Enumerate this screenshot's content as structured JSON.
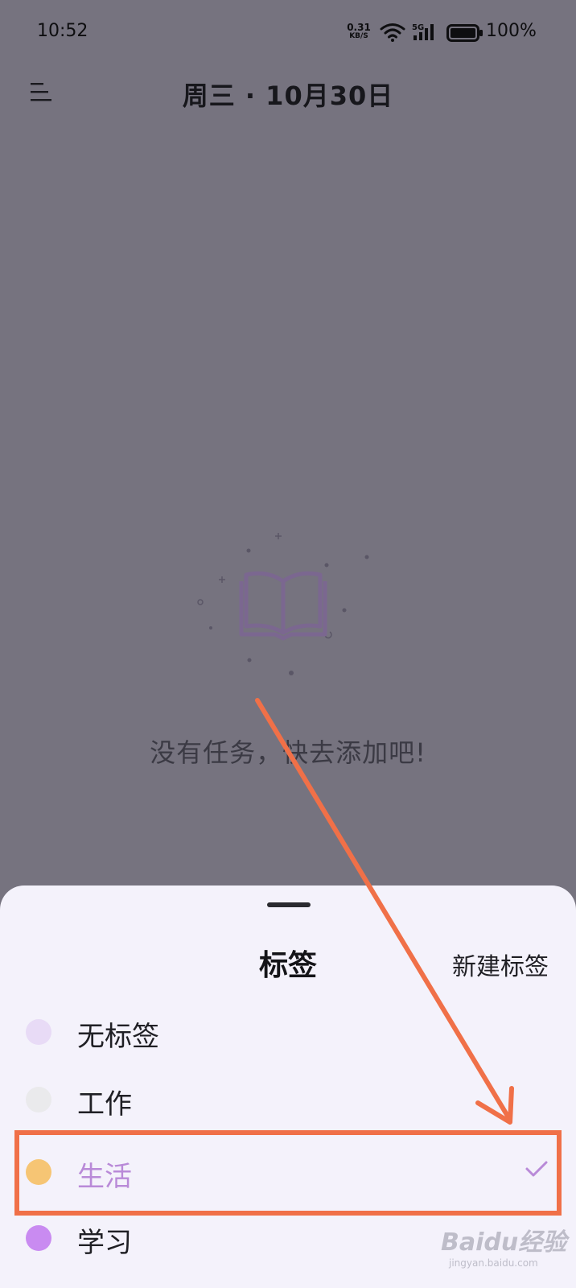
{
  "status_bar": {
    "time": "10:52",
    "net_speed_value": "0.31",
    "net_speed_unit": "KB/S",
    "signal_label": "5G",
    "battery": "100%"
  },
  "header": {
    "menu_icon": "menu-icon",
    "title": "周三 · 10月30日"
  },
  "empty_state": {
    "illustration": "open-book-icon",
    "message": "没有任务，快去添加吧!"
  },
  "sheet": {
    "title": "标签",
    "new_tag_label": "新建标签",
    "tags": [
      {
        "label": "无标签",
        "color": "#e8dbf6",
        "selected": false
      },
      {
        "label": "工作",
        "color": "#eaeaec",
        "selected": false
      },
      {
        "label": "生活",
        "color": "#f6c574",
        "selected": true
      },
      {
        "label": "学习",
        "color": "#c98bf1",
        "selected": false
      }
    ],
    "accent_color": "#b98ad8"
  },
  "watermark": {
    "brand": "Baidu经验",
    "url": "jingyan.baidu.com"
  }
}
